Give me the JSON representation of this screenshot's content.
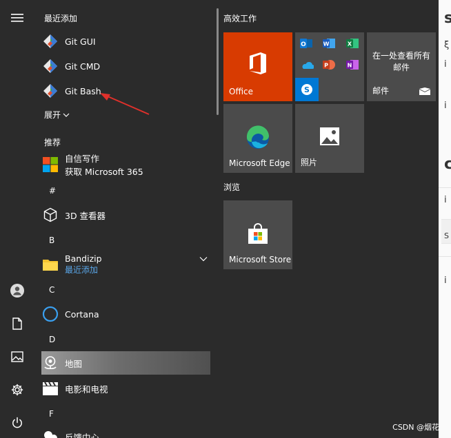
{
  "recent": {
    "heading": "最近添加",
    "items": [
      {
        "label": "Git GUI",
        "icon": "git-icon"
      },
      {
        "label": "Git CMD",
        "icon": "git-icon"
      },
      {
        "label": "Git Bash",
        "icon": "git-icon"
      }
    ],
    "expand_label": "展开"
  },
  "recommended": {
    "heading": "推荐",
    "item": {
      "line1": "自信写作",
      "line2": "获取 Microsoft 365",
      "icon": "microsoft-logo-icon"
    }
  },
  "sections": [
    {
      "letter": "#",
      "items": [
        {
          "label": "3D 查看器",
          "icon": "cube-icon"
        }
      ]
    },
    {
      "letter": "B",
      "items": [
        {
          "label": "Bandizip",
          "sub": "最近添加",
          "icon": "folder-icon"
        }
      ]
    },
    {
      "letter": "C",
      "items": [
        {
          "label": "Cortana",
          "icon": "cortana-icon"
        }
      ]
    },
    {
      "letter": "D",
      "items": [
        {
          "label": "地图",
          "icon": "maps-icon"
        },
        {
          "label": "电影和电视",
          "icon": "clapperboard-icon"
        }
      ]
    },
    {
      "letter": "F",
      "items": [
        {
          "label": "反馈中心",
          "icon": "feedback-icon"
        }
      ]
    }
  ],
  "tiles": {
    "group1_title": "高效工作",
    "group2_title": "浏览",
    "office": {
      "label": "Office"
    },
    "mail": {
      "text": "在一处查看所有邮件",
      "label": "邮件"
    },
    "edge": {
      "label": "Microsoft Edge"
    },
    "photos": {
      "label": "照片"
    },
    "store": {
      "label": "Microsoft Store"
    }
  },
  "rail_icons": [
    "hamburger-menu-icon",
    "user-avatar-icon",
    "document-icon",
    "pictures-icon",
    "settings-gear-icon",
    "power-icon"
  ],
  "watermark": "CSDN @烟花节",
  "colors": {
    "start_bg": "#2b2b2b",
    "office_tile": "#d83b01",
    "tile_bg": "#4b4b4b",
    "accent_link": "#5aa6e8",
    "arrow": "#e0302b"
  }
}
